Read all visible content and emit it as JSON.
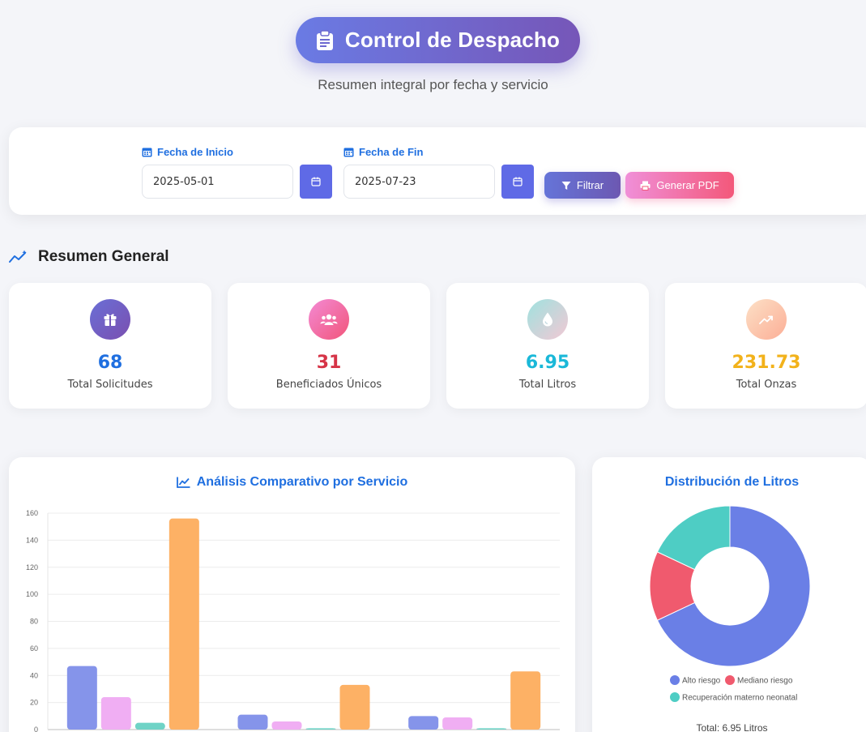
{
  "header": {
    "title": "Control de Despacho",
    "subtitle": "Resumen integral por fecha y servicio"
  },
  "filters": {
    "start_label": "Fecha de Inicio",
    "start_value": "2025-05-01",
    "end_label": "Fecha de Fin",
    "end_value": "2025-07-23",
    "filter_button": "Filtrar",
    "pdf_button": "Generar PDF"
  },
  "summary": {
    "heading": "Resumen General",
    "cards": [
      {
        "value": "68",
        "label": "Total Solicitudes",
        "color": "#1f6fe0",
        "icon": "gift-icon"
      },
      {
        "value": "31",
        "label": "Beneficiados Únicos",
        "color": "#d63447",
        "icon": "users-icon"
      },
      {
        "value": "6.95",
        "label": "Total Litros",
        "color": "#1ab8d8",
        "icon": "droplet-icon"
      },
      {
        "value": "231.73",
        "label": "Total Onzas",
        "color": "#f2b21b",
        "icon": "trend-up-icon"
      }
    ]
  },
  "chart_data": [
    {
      "type": "bar",
      "title": "Análisis Comparativo por Servicio",
      "ylim": [
        0,
        160
      ],
      "y_ticks": [
        0,
        20,
        40,
        60,
        80,
        100,
        120,
        140,
        160
      ],
      "grid": true,
      "series": [
        {
          "color": "#8594ea",
          "values": [
            47,
            11,
            10
          ]
        },
        {
          "color": "#f0aef3",
          "values": [
            24,
            6,
            9
          ]
        },
        {
          "color": "#6fd3c6",
          "values": [
            5,
            1,
            1
          ]
        },
        {
          "color": "#fdb165",
          "values": [
            156,
            33,
            43
          ]
        }
      ]
    },
    {
      "type": "pie",
      "title": "Distribución de Litros",
      "labels": [
        "Alto riesgo",
        "Mediano riesgo",
        "Recuperación materno neonatal"
      ],
      "colors": [
        "#6a7fe6",
        "#f05a6e",
        "#4ecdc4"
      ],
      "values": [
        68,
        14,
        18
      ],
      "total_label": "Total: 6.95 Litros",
      "legend_placement": "bottom"
    }
  ]
}
